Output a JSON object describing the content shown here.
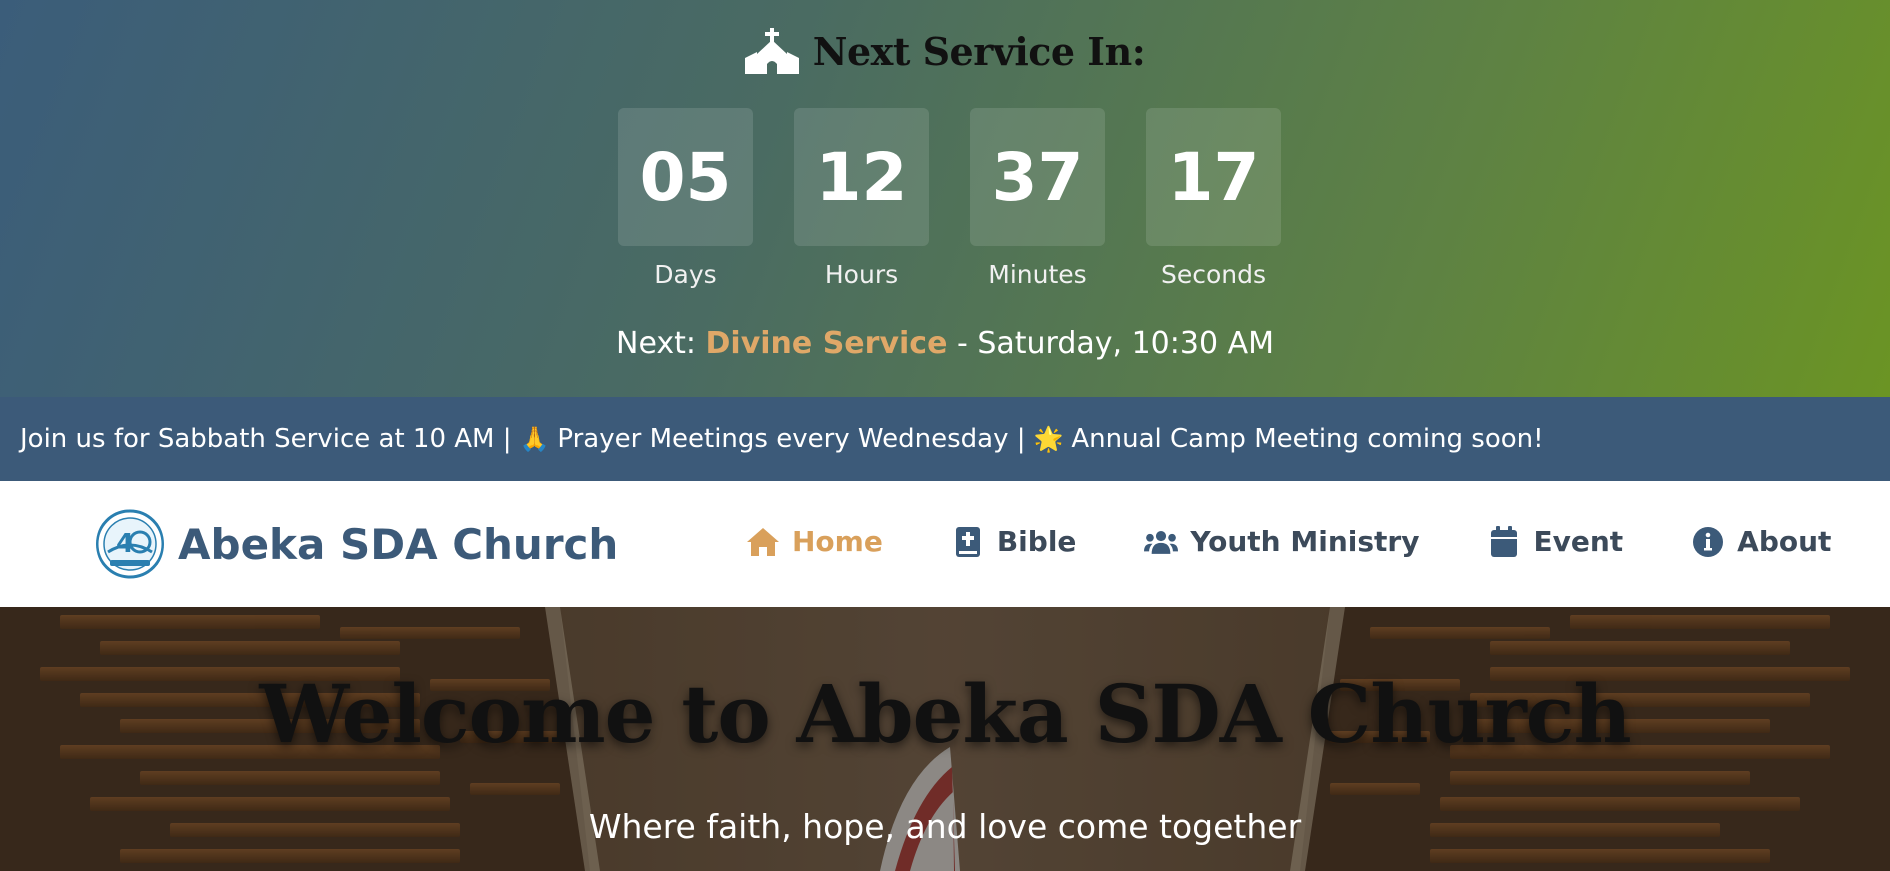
{
  "countdown": {
    "title": "Next Service In:",
    "units": [
      {
        "value": "05",
        "label": "Days"
      },
      {
        "value": "12",
        "label": "Hours"
      },
      {
        "value": "37",
        "label": "Minutes"
      },
      {
        "value": "17",
        "label": "Seconds"
      }
    ],
    "next_prefix": "Next: ",
    "next_service": "Divine Service",
    "next_suffix": " - Saturday, 10:30 AM",
    "icon": "church-icon"
  },
  "ticker": {
    "part1": "Join us for Sabbath Service at 10 AM | ",
    "emoji1": "🙏",
    "part2": "Prayer Meetings every Wednesday | ",
    "emoji2": "🌟",
    "part3": "Annual Camp Meeting coming soon!"
  },
  "navbar": {
    "brand": "Abeka SDA Church",
    "items": [
      {
        "label": "Home",
        "icon": "home-icon",
        "active": true
      },
      {
        "label": "Bible",
        "icon": "bible-icon",
        "active": false
      },
      {
        "label": "Youth Ministry",
        "icon": "users-icon",
        "active": false
      },
      {
        "label": "Event",
        "icon": "calendar-icon",
        "active": false
      },
      {
        "label": "About",
        "icon": "info-icon",
        "active": false
      }
    ]
  },
  "hero": {
    "title": "Welcome to Abeka SDA Church",
    "subtitle": "Where faith, hope, and love come together"
  },
  "colors": {
    "accent": "#d9a05b",
    "brand": "#3c5a79",
    "service_highlight": "#e0a868"
  }
}
